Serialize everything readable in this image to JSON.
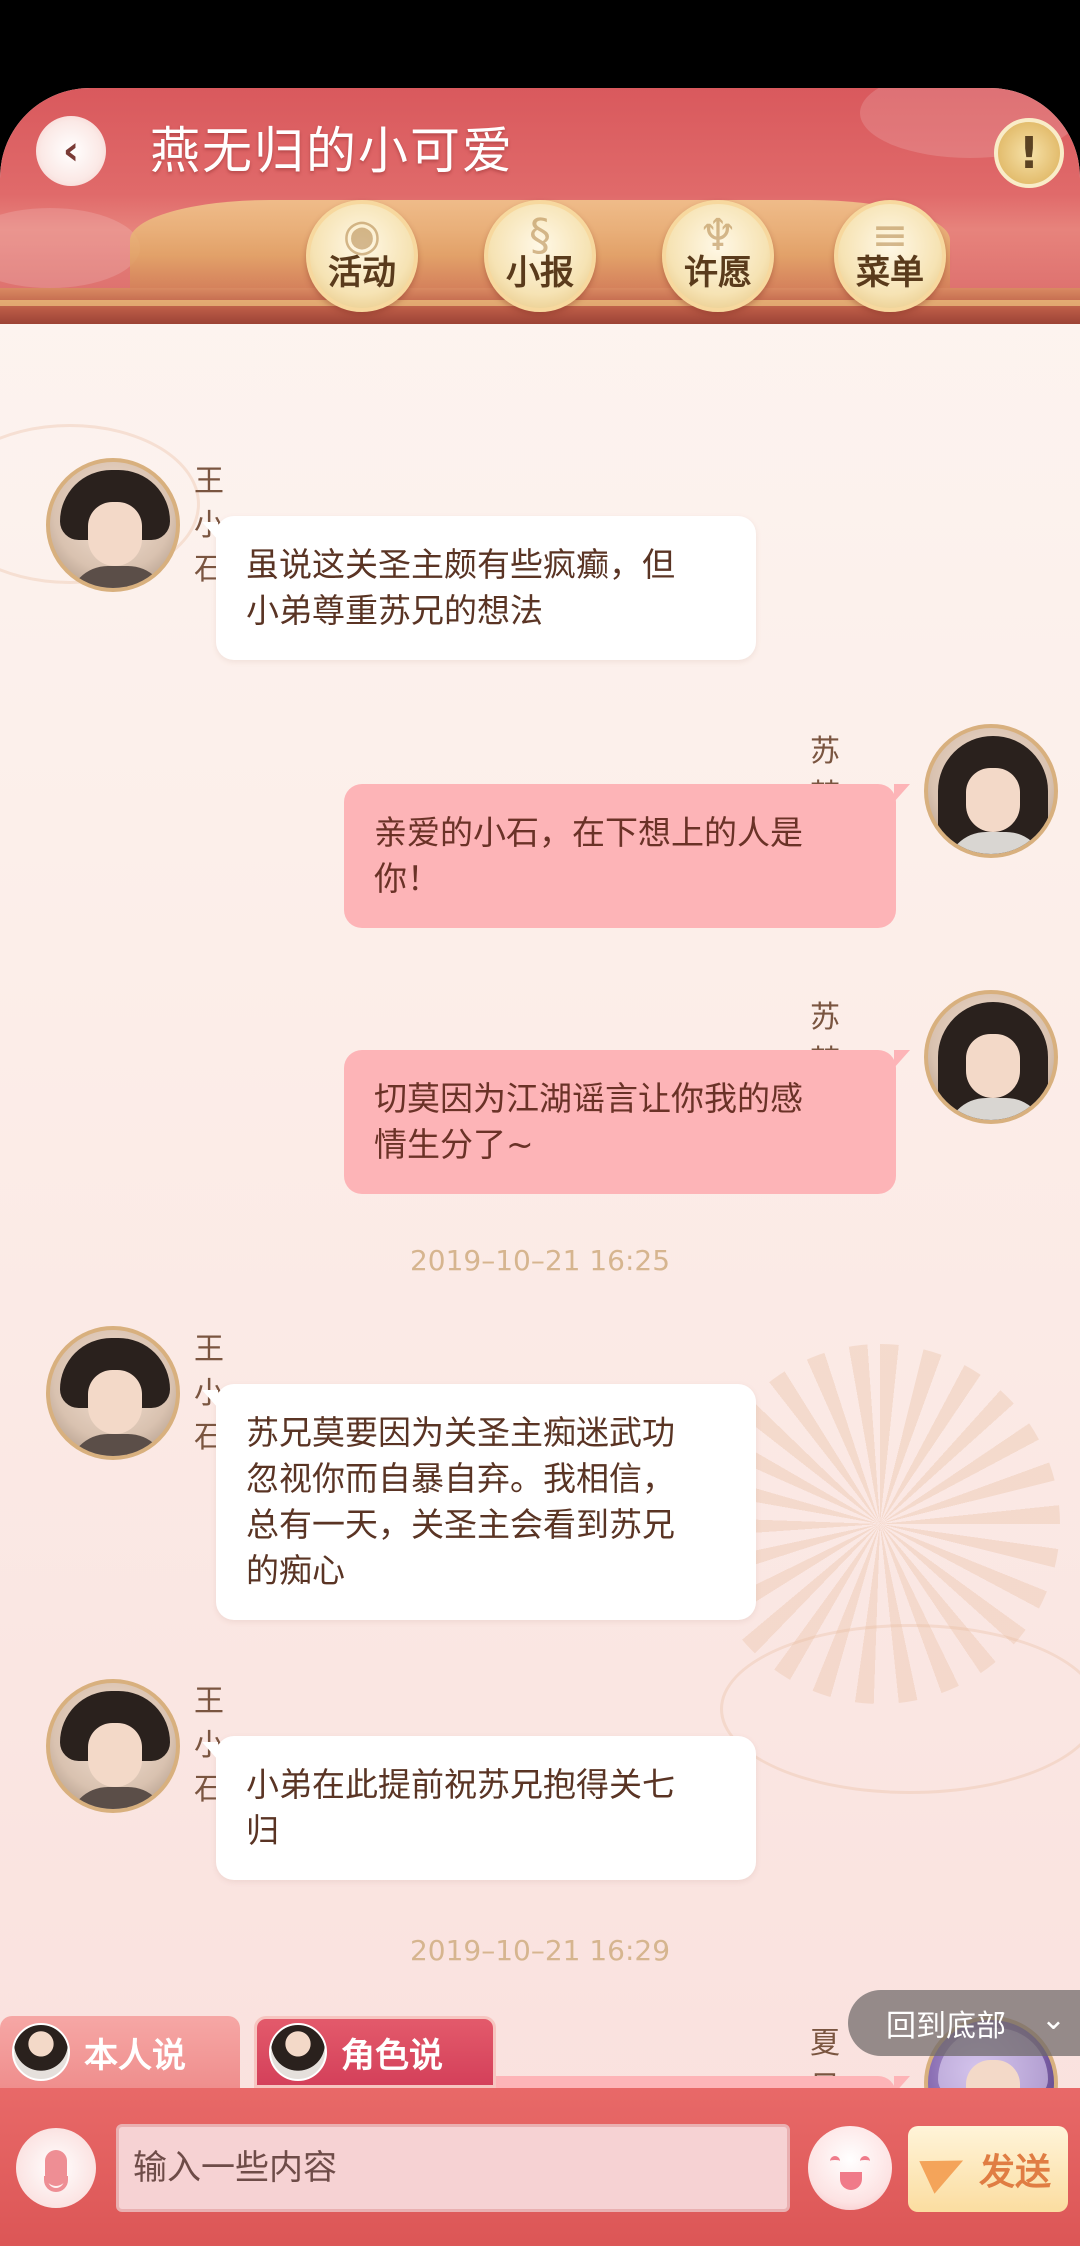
{
  "header": {
    "title": "燕无归的小可爱",
    "back_icon": "chevron-left-icon",
    "info_icon": "exclamation-icon",
    "nav": [
      {
        "label": "活动",
        "icon": "lantern-icon"
      },
      {
        "label": "小报",
        "icon": "scroll-icon"
      },
      {
        "label": "许愿",
        "icon": "fountain-icon"
      },
      {
        "label": "菜单",
        "icon": "menu-icon"
      }
    ]
  },
  "messages": [
    {
      "sender": "王小石",
      "side": "left",
      "text": "虽说这关圣主颇有些疯癫，但\n小弟尊重苏兄的想法"
    },
    {
      "sender": "苏梦枕",
      "side": "right",
      "text": "亲爱的小石，在下想上的人是\n你！"
    },
    {
      "sender": "苏梦枕",
      "side": "right",
      "text": "切莫因为江湖谣言让你我的感\n情生分了~"
    },
    {
      "sender": "王小石",
      "side": "left",
      "text": "苏兄莫要因为关圣主痴迷武功\n忽视你而自暴自弃。我相信，\n总有一天，关圣主会看到苏兄\n的痴心"
    },
    {
      "sender": "王小石",
      "side": "left",
      "text": "小弟在此提前祝苏兄抱得关七\n归"
    },
    {
      "sender": "夏目凌",
      "side": "right",
      "text": ""
    }
  ],
  "timestamps": [
    "2019–10–21 16:25",
    "2019–10–21 16:29"
  ],
  "scroll_to_bottom": {
    "label": "回到底部",
    "icon": "chevron-down-icon"
  },
  "tabs": [
    {
      "label": "本人说",
      "active": false
    },
    {
      "label": "角色说",
      "active": true
    }
  ],
  "input": {
    "placeholder": "输入一些内容",
    "value": ""
  },
  "send_label": "发送",
  "colors": {
    "header": "#dc5d5f",
    "bubble_right": "#fdb4b7",
    "bubble_left": "#ffffff",
    "timestamp": "#d6b58f",
    "input_bar": "#e36363",
    "send_text": "#e07d43"
  }
}
